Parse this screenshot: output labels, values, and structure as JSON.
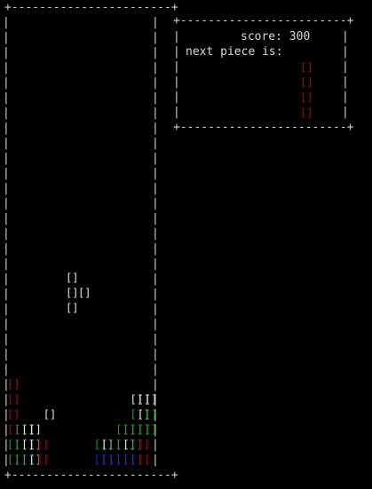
{
  "game": {
    "board": {
      "border_top": "+-----------------------+",
      "border_bottom": "+-----------------------+",
      "side_char": "|"
    },
    "info_panel": {
      "border_top": "+------------------------+",
      "border_bottom": "+------------------------+",
      "side_char": "|",
      "score_label": "score: 300",
      "next_label": "next piece is:"
    },
    "block_glyph": "[]",
    "colors": {
      "white": "#e6e6e6",
      "red": "#c80000",
      "green": "#1fa51f",
      "cyan": "#1fa5a5",
      "blue": "#1c2fd0"
    },
    "next_piece": {
      "color": "red",
      "cells": [
        [
          0,
          0
        ],
        [
          0,
          1
        ],
        [
          0,
          2
        ],
        [
          0,
          3
        ]
      ]
    },
    "active_piece": {
      "color": "white",
      "cells": [
        [
          0,
          0
        ],
        [
          0,
          1
        ],
        [
          1,
          1
        ],
        [
          0,
          2
        ]
      ]
    },
    "settled_rows": [
      [
        [
          "red",
          0
        ]
      ],
      [
        [
          "red",
          0
        ],
        [
          "white",
          17
        ],
        [
          "white",
          18
        ],
        [
          "white",
          19
        ]
      ],
      [
        [
          "red",
          0
        ],
        [
          "white",
          5
        ],
        [
          "green",
          17
        ],
        [
          "white",
          18
        ],
        [
          "green",
          19
        ]
      ],
      [
        [
          "red",
          0
        ],
        [
          "green",
          1
        ],
        [
          "white",
          2
        ],
        [
          "white",
          3
        ],
        [
          "green",
          15
        ],
        [
          "green",
          16
        ],
        [
          "green",
          17
        ],
        [
          "green",
          18
        ],
        [
          "green",
          19
        ]
      ],
      [
        [
          "green",
          0
        ],
        [
          "green",
          1
        ],
        [
          "white",
          2
        ],
        [
          "white",
          3
        ],
        [
          "red",
          4
        ],
        [
          "green",
          12
        ],
        [
          "white",
          13
        ],
        [
          "green",
          14
        ],
        [
          "green",
          15
        ],
        [
          "white",
          16
        ],
        [
          "green",
          17
        ],
        [
          "red",
          18
        ]
      ],
      [
        [
          "green",
          0
        ],
        [
          "green",
          1
        ],
        [
          "cyan",
          2
        ],
        [
          "white",
          3
        ],
        [
          "red",
          4
        ],
        [
          "blue",
          12
        ],
        [
          "blue",
          13
        ],
        [
          "blue",
          14
        ],
        [
          "blue",
          15
        ],
        [
          "blue",
          16
        ],
        [
          "blue",
          17
        ],
        [
          "red",
          18
        ]
      ]
    ]
  }
}
